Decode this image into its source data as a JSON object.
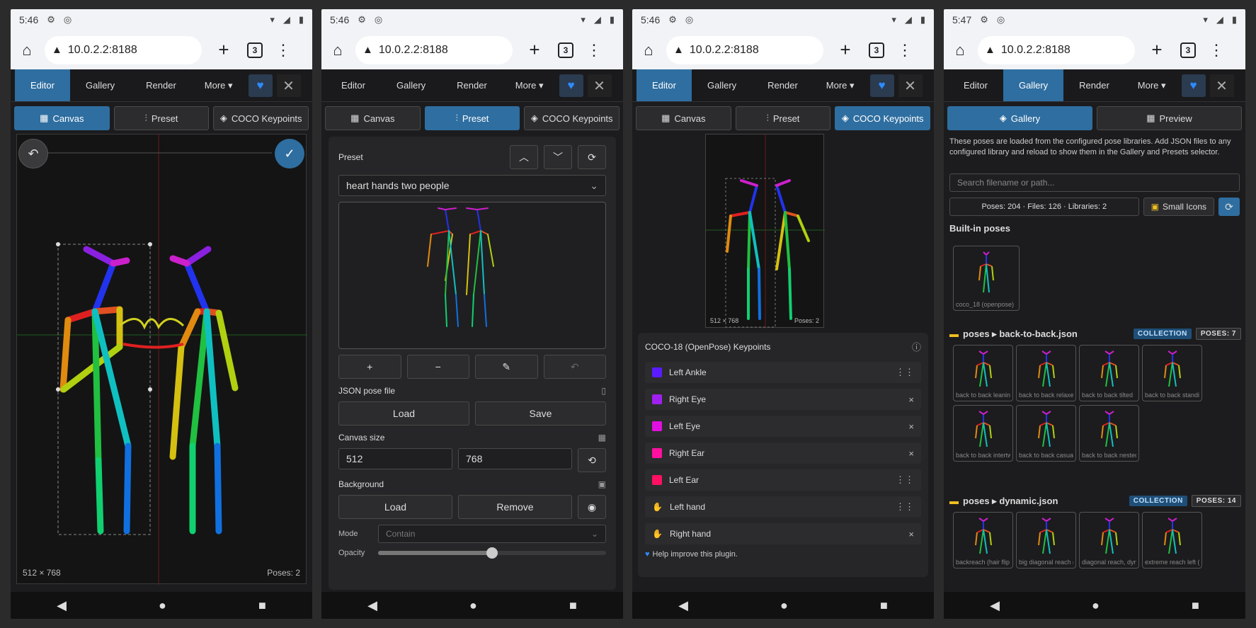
{
  "status": {
    "time_1": "5:46",
    "time_2": "5:46",
    "time_3": "5:46",
    "time_4": "5:47"
  },
  "browser": {
    "url": "10.0.2.2:8188",
    "tab_count": "3"
  },
  "nav": {
    "editor": "Editor",
    "gallery": "Gallery",
    "render": "Render",
    "more": "More ▾"
  },
  "subtabs": {
    "canvas": "Canvas",
    "preset": "Preset",
    "coco": "COCO Keypoints",
    "gallery": "Gallery",
    "preview": "Preview"
  },
  "editor": {
    "size_label": "512 × 768",
    "poses_label": "Poses: 2"
  },
  "preset": {
    "title": "Preset",
    "selected": "heart hands two people",
    "json_title": "JSON pose file",
    "load": "Load",
    "save": "Save",
    "canvas_size_title": "Canvas size",
    "width": "512",
    "height": "768",
    "background_title": "Background",
    "bg_load": "Load",
    "bg_remove": "Remove",
    "mode_label": "Mode",
    "mode_value": "Contain",
    "opacity_label": "Opacity",
    "opacity": 0.5
  },
  "coco": {
    "preview_size": "512 × 768",
    "preview_poses": "Poses: 2",
    "title": "COCO-18 (OpenPose) Keypoints",
    "keypoints": [
      {
        "name": "Left Ankle",
        "color": "#5a1cff",
        "action": "⋮⋮"
      },
      {
        "name": "Right Eye",
        "color": "#a020f0",
        "action": "×"
      },
      {
        "name": "Left Eye",
        "color": "#e010e0",
        "action": "×"
      },
      {
        "name": "Right Ear",
        "color": "#ff10a0",
        "action": "×"
      },
      {
        "name": "Left Ear",
        "color": "#ff1060",
        "action": "⋮⋮"
      },
      {
        "name": "Left hand",
        "icon": "✋",
        "action": "⋮⋮"
      },
      {
        "name": "Right hand",
        "icon": "✋",
        "action": "×"
      }
    ],
    "help": "Help improve this plugin."
  },
  "gallery": {
    "intro": "These poses are loaded from the configured pose libraries. Add JSON files to any configured library and reload to show them in the Gallery and Presets selector.",
    "search_placeholder": "Search filename or path...",
    "stats": "Poses: 204 · Files: 126 · Libraries: 2",
    "small_icons": "Small Icons",
    "builtin_title": "Built-in poses",
    "builtin_item": "coco_18 (openpose)",
    "group1_title": "poses ▸ back-to-back.json",
    "group1_tag": "COLLECTION",
    "group1_count": "POSES: 7",
    "group1_items": [
      "back to back leaning",
      "back to back relaxed",
      "back to back tilted",
      "back to back standi...",
      "back to back intertw...",
      "back to back casual",
      "back to back nested"
    ],
    "group2_title": "poses ▸ dynamic.json",
    "group2_tag": "COLLECTION",
    "group2_count": "POSES: 14",
    "group2_items": [
      "backreach (hair flip ...",
      "big diagonal reach (...",
      "diagonal reach, dyn...",
      "extreme reach left (..."
    ]
  },
  "colors": {
    "accent": "#2f6ea0",
    "panel": "#262628"
  }
}
